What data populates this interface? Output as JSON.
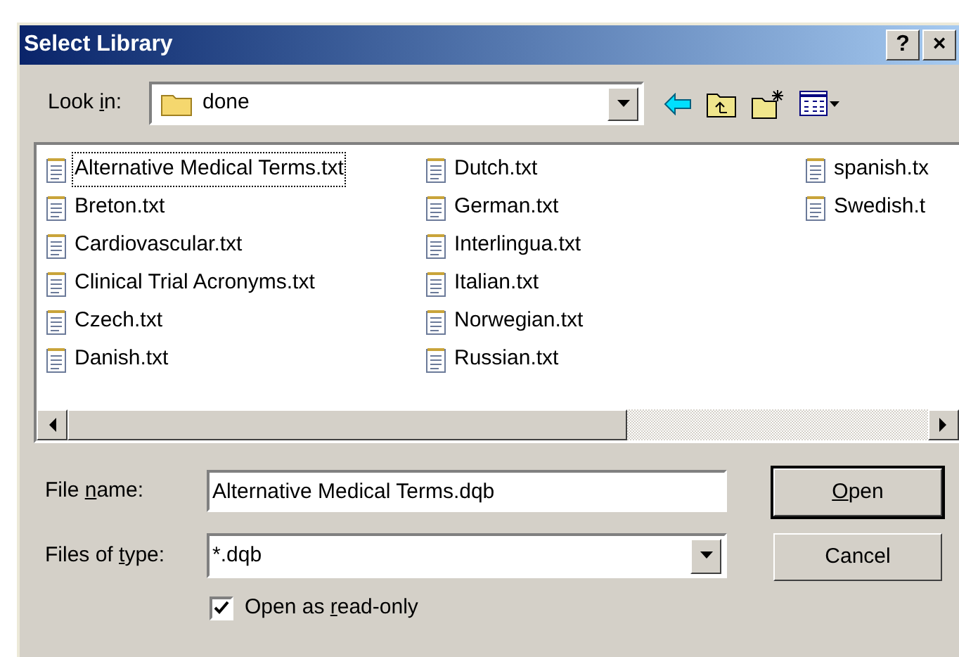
{
  "window": {
    "title": "Select Library",
    "title_buttons": [
      "?",
      "×"
    ]
  },
  "look_in": {
    "label": [
      {
        "text": "Look ",
        "underline": false
      },
      {
        "text": "i",
        "underline": true
      },
      {
        "text": "n:",
        "underline": false
      }
    ],
    "value": "done"
  },
  "file_list": {
    "columns": [
      {
        "items": [
          {
            "name": "Alternative Medical Terms.txt",
            "selected": true
          },
          {
            "name": "Breton.txt",
            "selected": false
          },
          {
            "name": "Cardiovascular.txt",
            "selected": false
          },
          {
            "name": "Clinical Trial Acronyms.txt",
            "selected": false
          },
          {
            "name": "Czech.txt",
            "selected": false
          },
          {
            "name": "Danish.txt",
            "selected": false
          }
        ]
      },
      {
        "items": [
          {
            "name": "Dutch.txt",
            "selected": false
          },
          {
            "name": "German.txt",
            "selected": false
          },
          {
            "name": "Interlingua.txt",
            "selected": false
          },
          {
            "name": "Italian.txt",
            "selected": false
          },
          {
            "name": "Norwegian.txt",
            "selected": false
          },
          {
            "name": "Russian.txt",
            "selected": false
          }
        ]
      },
      {
        "items": [
          {
            "name": "spanish.tx",
            "selected": false
          },
          {
            "name": "Swedish.t",
            "selected": false
          }
        ]
      }
    ]
  },
  "file_name": {
    "label": [
      {
        "text": "File ",
        "underline": false
      },
      {
        "text": "n",
        "underline": true
      },
      {
        "text": "ame:",
        "underline": false
      }
    ],
    "value": "Alternative Medical Terms.dqb"
  },
  "file_type": {
    "label": [
      {
        "text": "Files of ",
        "underline": false
      },
      {
        "text": "t",
        "underline": true
      },
      {
        "text": "ype:",
        "underline": false
      }
    ],
    "value": "*.dqb"
  },
  "read_only": {
    "label": [
      {
        "text": "Open as ",
        "underline": false
      },
      {
        "text": "r",
        "underline": true
      },
      {
        "text": "ead-only",
        "underline": false
      }
    ],
    "checked": true
  },
  "buttons": [
    {
      "label": [
        {
          "text": "O",
          "underline": true
        },
        {
          "text": "pen",
          "underline": false
        }
      ],
      "default": true
    },
    {
      "label": [
        {
          "text": "Cancel",
          "underline": false
        }
      ],
      "default": false
    }
  ]
}
